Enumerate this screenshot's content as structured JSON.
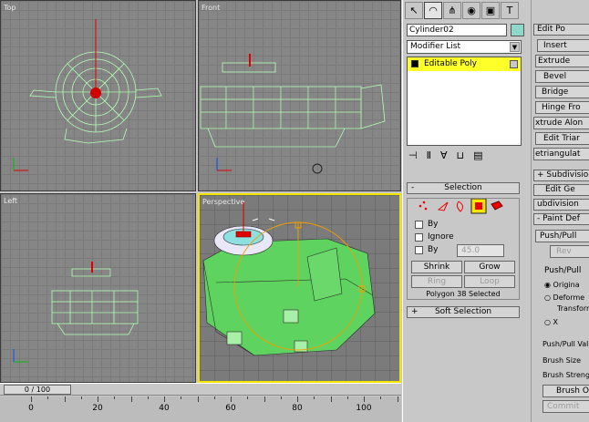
{
  "viewports": {
    "top": {
      "label": "Top"
    },
    "front": {
      "label": "Front"
    },
    "left": {
      "label": "Left"
    },
    "perspective": {
      "label": "Perspective"
    }
  },
  "timeline": {
    "frame_display": "0 / 100",
    "ruler_labels": [
      "0",
      "20",
      "40",
      "60",
      "80",
      "100"
    ]
  },
  "command_panel": {
    "tabs": [
      "create-icon",
      "modify-icon",
      "hierarchy-icon",
      "motion-icon",
      "display-icon",
      "utilities-icon"
    ],
    "object_name": "Cylinder02",
    "object_color": "#8fd8c9",
    "modifier_list_label": "Modifier List",
    "modifier_stack": [
      "Editable Poly"
    ],
    "selection_rollout": {
      "title": "Selection",
      "sign": "-",
      "by_vertex_label": "By",
      "ignore_backfacing_label": "Ignore",
      "by_angle_label": "By",
      "angle_value": "45.0",
      "shrink_label": "Shrink",
      "grow_label": "Grow",
      "ring_label": "Ring",
      "loop_label": "Loop",
      "status": "Polygon 38 Selected"
    },
    "soft_selection_rollout": {
      "title": "Soft Selection",
      "sign": "+"
    }
  },
  "edit_panel": {
    "edit_poly_title": "Edit Po",
    "insert_label": "Insert",
    "extrude_label": "Extrude",
    "bevel_label": "Bevel",
    "bridge_label": "Bridge",
    "hinge_label": "Hinge Fro",
    "extrude_along_label": "xtrude Alon",
    "edit_tri_label": "Edit Triar",
    "retriangulate_label": "etriangulat",
    "subdivision_surface": "+ Subdivisio",
    "edit_geometry": "Edit Ge",
    "subdivision_displacement": "ubdivision",
    "paint_deformation": "- Paint Def",
    "push_pull_label": "Push/Pull",
    "revert_label": "Rev",
    "push_pull_dir_title": "Push/Pull",
    "original_normals": "Origina",
    "deformed_normals": "Deforme",
    "transform_label": "Transform",
    "x_label": "X",
    "push_pull_value_label": "Push/Pull Valu",
    "brush_size_label": "Brush Size",
    "brush_strength_label": "Brush Strength",
    "brush_options_label": "Brush O",
    "commit_label": "Commit"
  },
  "colors": {
    "mesh": "#b3ffb3",
    "selected_poly": "#5fd35f",
    "active_border": "#f2e600",
    "stack_highlight": "#ffff29"
  }
}
